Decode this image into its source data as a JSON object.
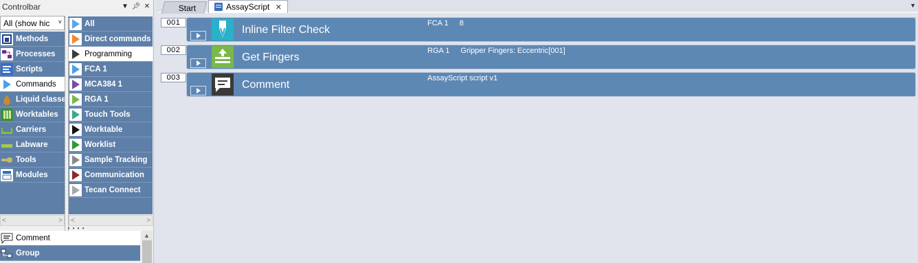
{
  "controlbar": {
    "title": "Controlbar",
    "filter_value": "All (show hic",
    "groups": [
      {
        "label": "Methods",
        "icon": "methods-icon",
        "color": "#1f3f8a"
      },
      {
        "label": "Processes",
        "icon": "processes-icon",
        "color": "#7a2a8c"
      },
      {
        "label": "Scripts",
        "icon": "scripts-icon",
        "color": "#3a6fc4"
      },
      {
        "label": "Commands",
        "icon": "commands-icon",
        "color": "#4aa0e8",
        "selected": true
      },
      {
        "label": "Liquid classe",
        "icon": "liquid-drop-icon",
        "color": "#c88a2a"
      },
      {
        "label": "Worktables",
        "icon": "worktable-icon",
        "color": "#3f8f3a"
      },
      {
        "label": "Carriers",
        "icon": "carrier-icon",
        "color": "#8bbd3a"
      },
      {
        "label": "Labware",
        "icon": "labware-icon",
        "color": "#a6c84a"
      },
      {
        "label": "Tools",
        "icon": "tools-icon",
        "color": "#c8b860"
      },
      {
        "label": "Modules",
        "icon": "modules-icon",
        "color": "#2f6fb0"
      }
    ],
    "commands": [
      {
        "label": "All",
        "icon": "all-commands-icon",
        "color": "#5aa8e8"
      },
      {
        "label": "Direct commands",
        "icon": "direct-commands-icon",
        "color": "#f08a2a"
      },
      {
        "label": "Programming",
        "icon": "programming-icon",
        "color": "#3a3a3a",
        "selected": true
      },
      {
        "label": "FCA 1",
        "icon": "fca-icon",
        "color": "#4aa0e8"
      },
      {
        "label": "MCA384 1",
        "icon": "mca384-icon",
        "color": "#7a4aa8"
      },
      {
        "label": "RGA 1",
        "icon": "rga-icon",
        "color": "#7ab84a"
      },
      {
        "label": "Touch Tools",
        "icon": "touch-tools-icon",
        "color": "#3aa88a"
      },
      {
        "label": "Worktable",
        "icon": "worktable-command-icon",
        "color": "#111111"
      },
      {
        "label": "Worklist",
        "icon": "worklist-icon",
        "color": "#2f9a3a"
      },
      {
        "label": "Sample Tracking",
        "icon": "sample-tracking-icon",
        "color": "#8a8a8a"
      },
      {
        "label": "Communication",
        "icon": "communication-icon",
        "color": "#8a2a2a"
      },
      {
        "label": "Tecan Connect",
        "icon": "tecan-connect-icon",
        "color": "#a8a8a8"
      }
    ],
    "favorites": [
      {
        "label": "Comment",
        "icon": "comment-icon",
        "selected": true
      },
      {
        "label": "Group",
        "icon": "group-icon"
      }
    ]
  },
  "tabs": [
    {
      "label": "Start",
      "active": false
    },
    {
      "label": "AssayScript",
      "active": true
    }
  ],
  "steps": [
    {
      "number": "001",
      "title": "Inline Filter Check",
      "device": "FCA 1",
      "params": "8",
      "icon": "inline-filter-icon",
      "icon_color": "#2ab0c8"
    },
    {
      "number": "002",
      "title": "Get Fingers",
      "device": "RGA 1",
      "params": "Gripper Fingers: Eccentric[001]",
      "icon": "get-fingers-icon",
      "icon_color": "#7ab84a"
    },
    {
      "number": "003",
      "title": "Comment",
      "device": "",
      "params": "AssayScript script v1",
      "icon": "comment-icon",
      "icon_color": "#3a3a3a"
    }
  ]
}
